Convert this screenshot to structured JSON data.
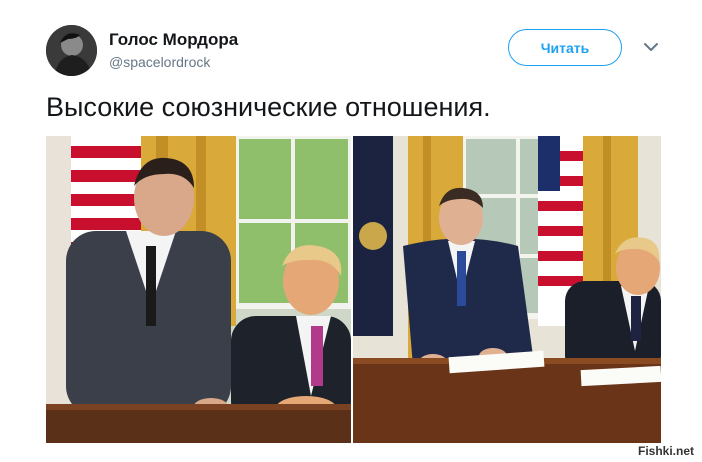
{
  "tweet": {
    "author": {
      "display_name": "Голос Мордора",
      "handle": "@spacelordrock"
    },
    "follow_label": "Читать",
    "text": "Высокие союзнические отношения.",
    "photos": [
      {
        "name": "photo-left"
      },
      {
        "name": "photo-right"
      }
    ]
  },
  "watermark": "Fishki.net",
  "colors": {
    "accent": "#1da1f2",
    "text_primary": "#14171a",
    "text_secondary": "#657786"
  },
  "icons": {
    "caret": "chevron-down-icon"
  }
}
